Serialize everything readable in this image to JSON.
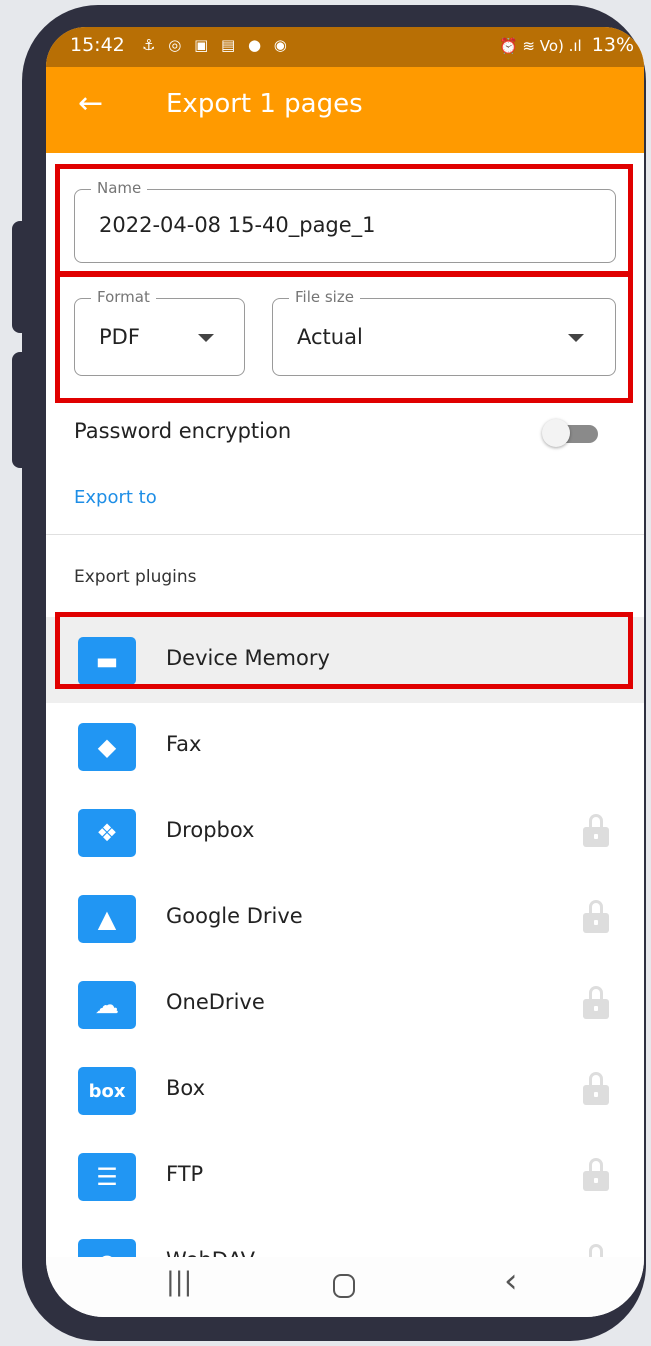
{
  "status_bar": {
    "time": "15:42",
    "left_icons": "⚓ ◎ ▣ ▤ ● ◉",
    "right_icons": "⏰ ≋ Vo) .ıl",
    "battery": "13%"
  },
  "app_bar": {
    "back_icon": "←",
    "title": "Export 1 pages"
  },
  "name_field": {
    "label": "Name",
    "value": "2022-04-08 15-40_page_1"
  },
  "format_field": {
    "label": "Format",
    "value": "PDF"
  },
  "file_size_field": {
    "label": "File size",
    "value": "Actual"
  },
  "password": {
    "label": "Password encryption",
    "enabled": false
  },
  "export_to_label": "Export to",
  "plugins_header": "Export plugins",
  "plugins": [
    {
      "label": "Device Memory",
      "icon": "folder-icon",
      "glyph": "▬",
      "locked": false
    },
    {
      "label": "Fax",
      "icon": "fax-icon",
      "glyph": "◆",
      "locked": false
    },
    {
      "label": "Dropbox",
      "icon": "dropbox-icon",
      "glyph": "❖",
      "locked": true
    },
    {
      "label": "Google Drive",
      "icon": "google-drive-icon",
      "glyph": "▲",
      "locked": true
    },
    {
      "label": "OneDrive",
      "icon": "onedrive-icon",
      "glyph": "☁",
      "locked": true
    },
    {
      "label": "Box",
      "icon": "box-icon",
      "glyph": "box",
      "locked": true
    },
    {
      "label": "FTP",
      "icon": "ftp-icon",
      "glyph": "☰",
      "locked": true
    },
    {
      "label": "WebDAV",
      "icon": "webdav-icon",
      "glyph": "⊕",
      "locked": true
    }
  ],
  "nav": {
    "recents": "|||",
    "back": "‹"
  },
  "colors": {
    "app_bar": "#ff9a00",
    "status_bar": "#b86f05",
    "accent_link": "#1e8ee6",
    "plugin_icon": "#2196f3",
    "annotation_red": "#e00000"
  }
}
